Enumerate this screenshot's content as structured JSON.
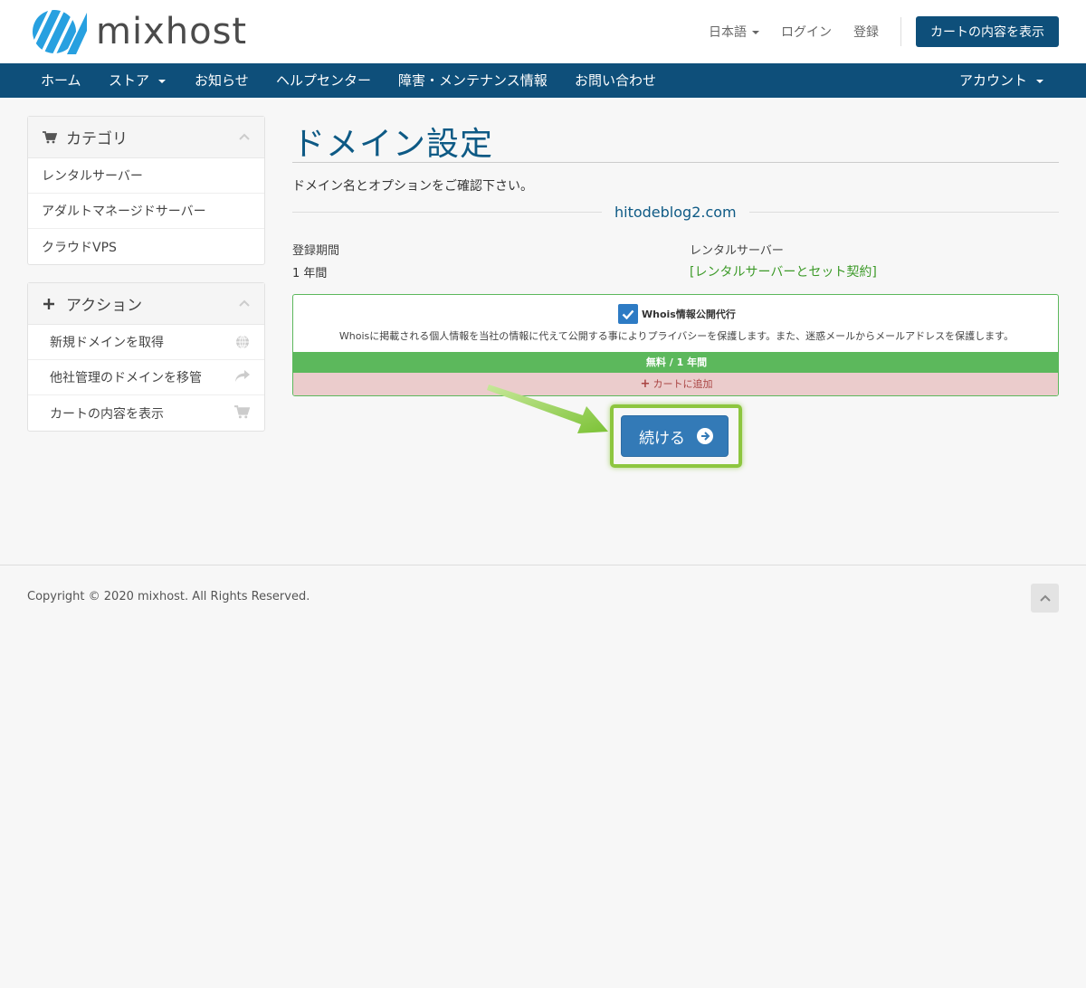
{
  "header": {
    "logo_text": "mixhost",
    "language": "日本語",
    "login": "ログイン",
    "register": "登録",
    "cart_button": "カートの内容を表示"
  },
  "nav": {
    "home": "ホーム",
    "store": "ストア",
    "news": "お知らせ",
    "help": "ヘルプセンター",
    "status": "障害・メンテナンス情報",
    "contact": "お問い合わせ",
    "account": "アカウント"
  },
  "sidebar": {
    "categories_title": "カテゴリ",
    "categories": [
      "レンタルサーバー",
      "アダルトマネージドサーバー",
      "クラウドVPS"
    ],
    "actions_title": "アクション",
    "actions": [
      "新規ドメインを取得",
      "他社管理のドメインを移管",
      "カートの内容を表示"
    ]
  },
  "main": {
    "title": "ドメイン設定",
    "intro": "ドメイン名とオプションをご確認下さい。",
    "domain": "hitodeblog2.com",
    "period_label": "登録期間",
    "period_value": "1 年間",
    "server_label": "レンタルサーバー",
    "server_link": "[レンタルサーバーとセット契約]",
    "addon": {
      "title": "Whois情報公開代行",
      "description": "Whoisに掲載される個人情報を当社の情報に代えて公開する事によりプライバシーを保護します。また、迷惑メールからメールアドレスを保護します。",
      "price": "無料 / 1 年間",
      "add_label": "カートに追加",
      "checked": true
    },
    "continue_button": "続ける"
  },
  "footer": {
    "copyright": "Copyright © 2020 mixhost. All Rights Reserved."
  },
  "colors": {
    "brand": "#0e4f7a",
    "title": "#0e5a85",
    "success": "#5cb85c",
    "danger_bg": "#ebcccc",
    "primary_button": "#337ab7",
    "highlight": "#8dc63f"
  }
}
